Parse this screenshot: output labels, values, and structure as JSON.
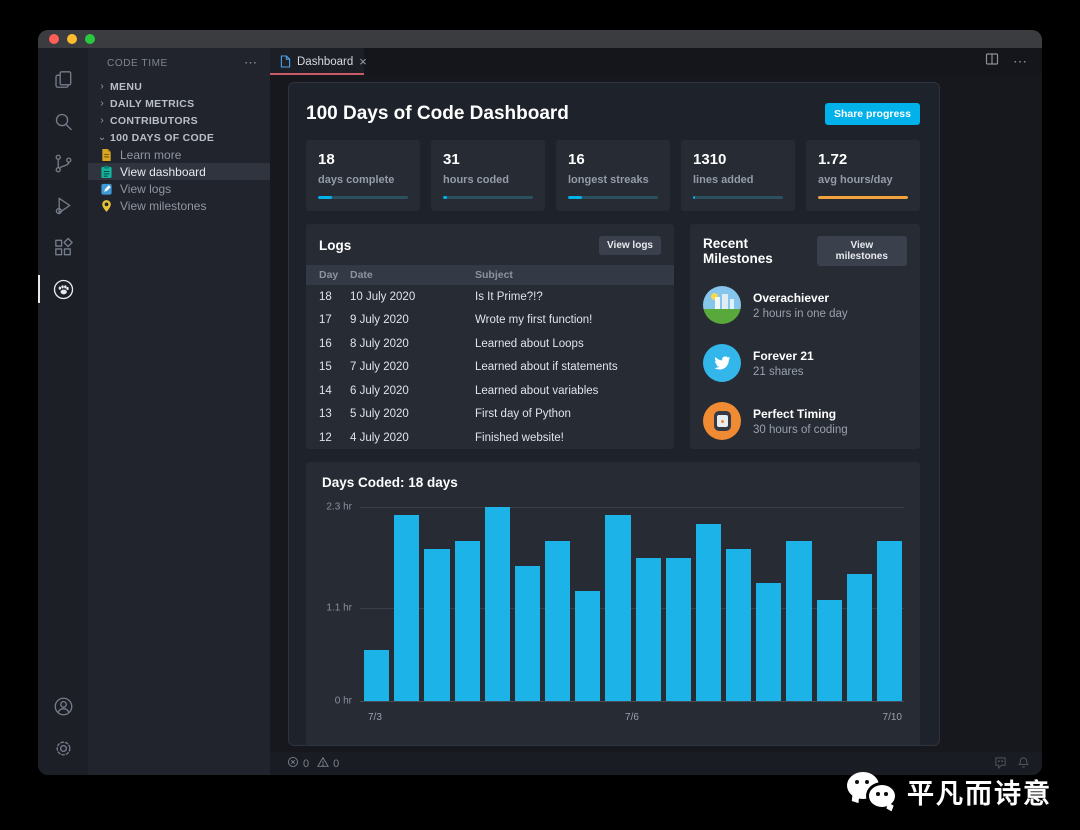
{
  "window": {
    "tab": {
      "label": "Dashboard",
      "close_glyph": "×"
    },
    "tab_actions": {
      "more_glyph": "⋯"
    },
    "statusbar": {
      "error_count": "0",
      "warning_count": "0"
    }
  },
  "activity_bar": {
    "top_items": [
      "files-icon",
      "search-icon",
      "source-control-icon",
      "run-debug-icon",
      "extensions-icon",
      "code-time-paw-icon"
    ],
    "active_item": "code-time-paw-icon",
    "bottom_items": [
      "account-icon",
      "settings-icon"
    ]
  },
  "sidebar": {
    "title": "CODE TIME",
    "more_glyph": "⋯",
    "sections": [
      {
        "label": "MENU",
        "expanded": false
      },
      {
        "label": "DAILY METRICS",
        "expanded": false
      },
      {
        "label": "CONTRIBUTORS",
        "expanded": false
      },
      {
        "label": "100 DAYS OF CODE",
        "expanded": true
      }
    ],
    "children": [
      {
        "label": "Learn more",
        "icon": "document-icon",
        "selected": false
      },
      {
        "label": "View dashboard",
        "icon": "dashboard-icon",
        "selected": true
      },
      {
        "label": "View logs",
        "icon": "edit-log-icon",
        "selected": false
      },
      {
        "label": "View milestones",
        "icon": "milestone-pin-icon",
        "selected": false
      }
    ]
  },
  "dashboard": {
    "title": "100 Days of Code Dashboard",
    "share_button": "Share progress",
    "stats": [
      {
        "value": "18",
        "label": "days complete",
        "progress": 16,
        "color": "#00b1ea"
      },
      {
        "value": "31",
        "label": "hours coded",
        "progress": 4,
        "color": "#00b1ea"
      },
      {
        "value": "16",
        "label": "longest streaks",
        "progress": 16,
        "color": "#00b1ea"
      },
      {
        "value": "1310",
        "label": "lines added",
        "progress": 2,
        "color": "#00b1ea"
      },
      {
        "value": "1.72",
        "label": "avg hours/day",
        "progress": 100,
        "color": "#f2a33c"
      }
    ],
    "logs": {
      "title": "Logs",
      "button": "View logs",
      "columns": [
        "Day",
        "Date",
        "Subject"
      ],
      "rows": [
        [
          "18",
          "10 July 2020",
          "Is It Prime?!?"
        ],
        [
          "17",
          "9 July 2020",
          "Wrote my first function!"
        ],
        [
          "16",
          "8 July 2020",
          "Learned about Loops"
        ],
        [
          "15",
          "7 July 2020",
          "Learned about if statements"
        ],
        [
          "14",
          "6 July 2020",
          "Learned about variables"
        ],
        [
          "13",
          "5 July 2020",
          "First day of Python"
        ],
        [
          "12",
          "4 July 2020",
          "Finished website!"
        ]
      ]
    },
    "milestones": {
      "title": "Recent Milestones",
      "button": "View milestones",
      "items": [
        {
          "name": "Overachiever",
          "desc": "2 hours in one day",
          "icon": "city-badge-icon"
        },
        {
          "name": "Forever 21",
          "desc": "21 shares",
          "icon": "twitter-badge-icon"
        },
        {
          "name": "Perfect Timing",
          "desc": "30 hours of coding",
          "icon": "watch-badge-icon"
        }
      ]
    }
  },
  "chart_data": {
    "type": "bar",
    "title": "Days Coded: 18 days",
    "values": [
      0.6,
      2.2,
      1.8,
      1.9,
      2.3,
      1.6,
      1.9,
      1.3,
      2.2,
      1.7,
      1.7,
      2.1,
      1.8,
      1.4,
      1.9,
      1.2,
      1.5,
      1.9
    ],
    "ylim": [
      0,
      2.3
    ],
    "y_ticks": [
      "2.3 hr",
      "1.1 hr",
      "0 hr"
    ],
    "x_tick_labels": [
      "7/3",
      "7/6",
      "7/10"
    ],
    "bar_color": "#1cb4e8",
    "grid": true,
    "legend": "none"
  },
  "watermark": {
    "text": "平凡而诗意"
  }
}
